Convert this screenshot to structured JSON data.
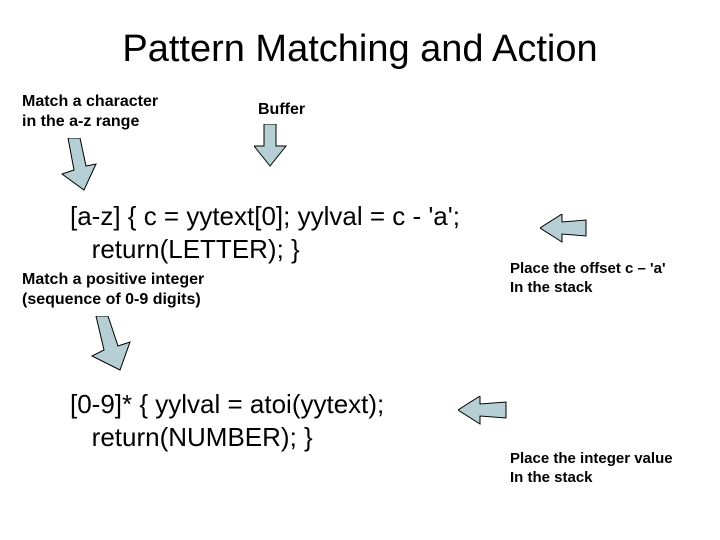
{
  "title": "Pattern Matching and Action",
  "labels": {
    "match_char": "Match a character\nin the a-z range",
    "buffer": "Buffer",
    "match_int": "Match a positive integer\n(sequence of 0-9 digits)"
  },
  "captions": {
    "offset": "Place the offset c – 'a'\nIn the stack",
    "int_value": "Place the integer value\nIn the stack"
  },
  "code": {
    "rule1_line1": "[a-z] { c = yytext[0]; yylval = c - 'a';",
    "rule1_line2": "   return(LETTER); }",
    "rule2_line1": "[0-9]* { yylval = atoi(yytext);",
    "rule2_line2": "   return(NUMBER); }"
  },
  "arrow_fill": "#b5cfd4",
  "arrow_stroke": "#000000"
}
